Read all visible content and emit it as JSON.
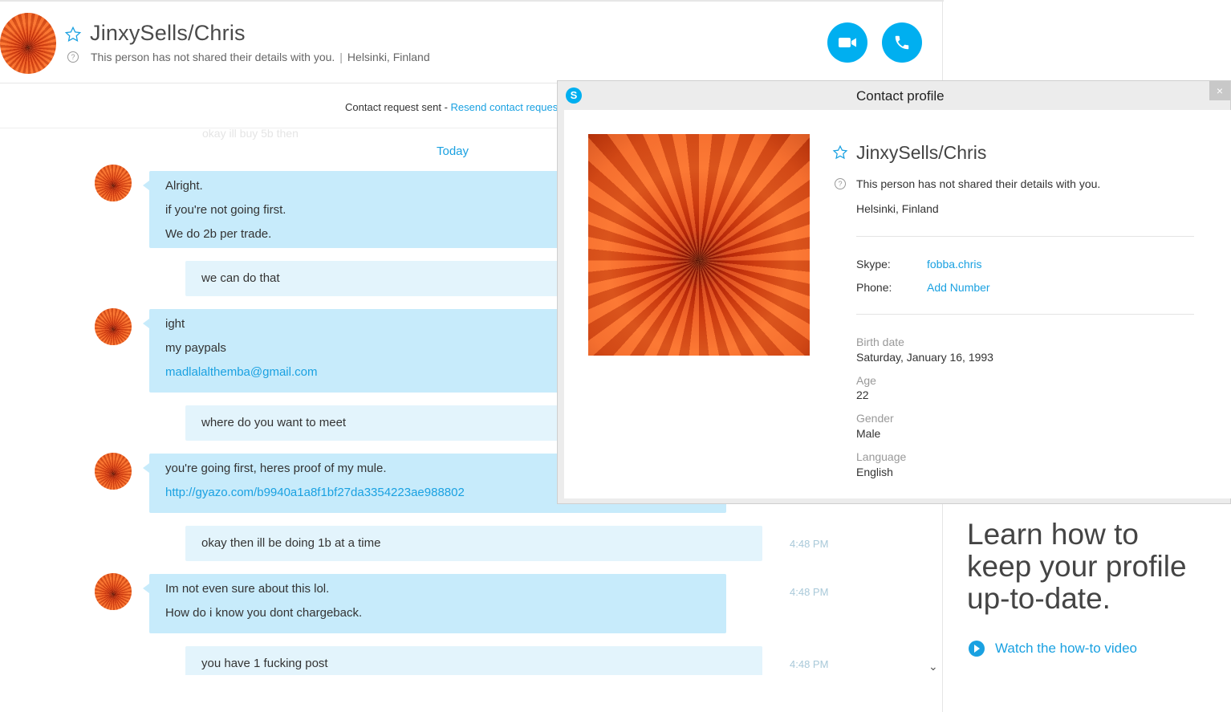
{
  "contact": {
    "name": "JinxySells/Chris",
    "status": "This person has not shared their details with you.",
    "location": "Helsinki, Finland",
    "separator": "|"
  },
  "notice": {
    "text": "Contact request sent -",
    "link": "Resend contact request"
  },
  "chat": {
    "ghost_text": "okay ill buy 5b then",
    "date_label": "Today",
    "messages": [
      {
        "dir": "in",
        "lines": [
          "Alright.",
          "if you're not going first.",
          "We do 2b per trade."
        ],
        "time": ""
      },
      {
        "dir": "out",
        "lines": [
          "we can do that"
        ],
        "time": ""
      },
      {
        "dir": "in",
        "lines": [
          "ight",
          "my paypals",
          "madlalalthemba@gmail.com"
        ],
        "time": ""
      },
      {
        "dir": "out",
        "lines": [
          "where do you want to meet"
        ],
        "time": ""
      },
      {
        "dir": "in",
        "lines": [
          "you're going first, heres proof of my mule.",
          "http://gyazo.com/b9940a1a8f1bf27da3354223ae988802"
        ],
        "time": ""
      },
      {
        "dir": "out",
        "lines": [
          "okay then ill be doing 1b at a time"
        ],
        "time": "4:48 PM"
      },
      {
        "dir": "in",
        "lines": [
          "Im not even sure about this lol.",
          "How do i know you dont chargeback."
        ],
        "time": "4:48 PM"
      },
      {
        "dir": "out",
        "lines": [
          "you have 1 fucking post"
        ],
        "time": "4:48 PM"
      }
    ]
  },
  "side_panel": {
    "learn_lines": [
      "Learn how to",
      "keep your profile",
      "up-to-date."
    ],
    "watch_label": "Watch the how-to video"
  },
  "popup": {
    "logo": "S",
    "title": "Contact profile",
    "close": "×",
    "name": "JinxySells/Chris",
    "status": "This person has not shared their details with you.",
    "location": "Helsinki, Finland",
    "skype_label": "Skype:",
    "skype_value": "fobba.chris",
    "phone_label": "Phone:",
    "phone_value": "Add Number",
    "birth_label": "Birth date",
    "birth_value": "Saturday, January 16, 1993",
    "age_label": "Age",
    "age_value": "22",
    "gender_label": "Gender",
    "gender_value": "Male",
    "language_label": "Language",
    "language_value": "English"
  },
  "colors": {
    "accent": "#00aff0",
    "link": "#1aa1e1",
    "incoming_bubble": "#c7ebfb",
    "outgoing_bubble": "#e3f4fc"
  }
}
